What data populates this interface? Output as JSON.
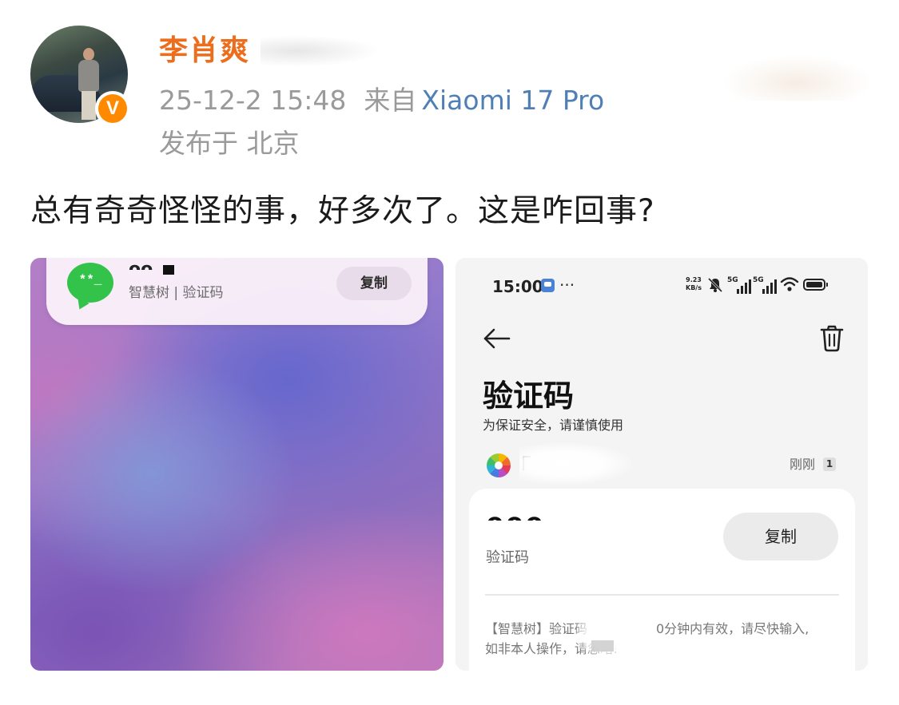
{
  "post": {
    "username": "李肖爽",
    "time": "25-12-2 15:48",
    "from_label": "来自",
    "device": "Xiaomi 17 Pro",
    "location": "发布于 北京",
    "text": "总有奇奇怪怪的事，好多次了。这是咋回事?",
    "verified_badge": "V"
  },
  "left_screenshot": {
    "notification": {
      "icon_glyph": "**_",
      "title_fragment": "ᴖᴖ",
      "subtitle": "智慧树 | 验证码",
      "copy_label": "复制"
    }
  },
  "right_screenshot": {
    "status_bar": {
      "time": "15:00",
      "dots": "···",
      "net_speed_value": "9.23",
      "net_speed_unit": "KB/s",
      "sim1_label": "5G",
      "sim2_label": "5G"
    },
    "page_title": "验证码",
    "page_subtitle": "为保证安全，请谨慎使用",
    "sender": {
      "received_time": "刚刚",
      "unread_count": "1"
    },
    "sms_card": {
      "code_fragment": "ᴖᴖᴖ",
      "code_label": "验证码",
      "copy_label": "复制",
      "body_line1_a": "【智慧树】验证码",
      "body_line1_b": "0分钟内有效，请尽快输入,",
      "body_line2": "如非本人操作，请忽略!"
    }
  },
  "colors": {
    "username": "#ec6d1c",
    "device_link": "#4f7fb5",
    "meta_gray": "#9a9a9a",
    "badge_orange": "#ff8a00",
    "notification_green": "#34c34a"
  }
}
